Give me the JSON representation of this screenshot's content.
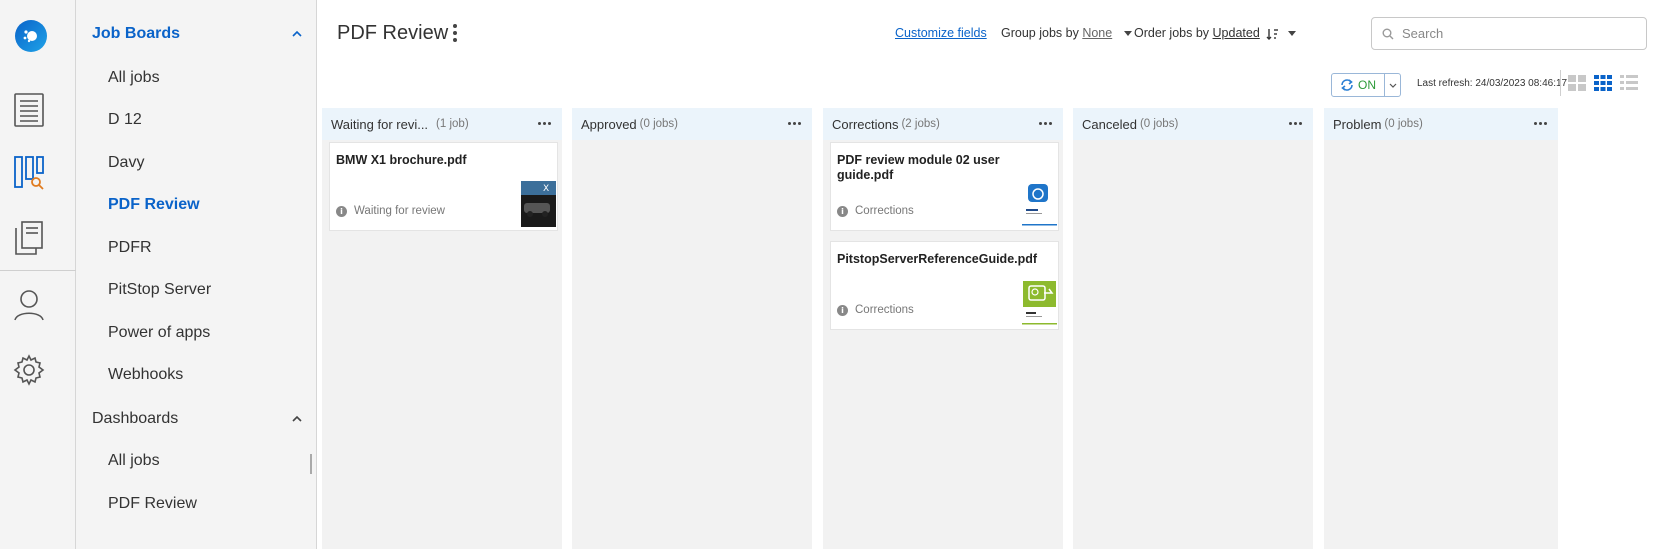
{
  "sidebar": {
    "sections": [
      {
        "label": "Job Boards",
        "items": [
          "All jobs",
          "D 12",
          "Davy",
          "PDF Review",
          "PDFR",
          "PitStop Server",
          "Power of apps",
          "Webhooks"
        ]
      },
      {
        "label": "Dashboards",
        "items": [
          "All jobs",
          "PDF Review"
        ]
      }
    ],
    "active_item": "PDF Review"
  },
  "header": {
    "title": "PDF Review",
    "customize_fields": "Customize fields",
    "group_label": "Group jobs by",
    "group_value": "None",
    "order_label": "Order jobs by",
    "order_value": "Updated",
    "search_placeholder": "Search"
  },
  "refresh": {
    "toggle_label": "ON",
    "last_refresh": "Last refresh: 24/03/2023 08:46:17"
  },
  "columns": [
    {
      "title": "Waiting for revi...",
      "count": "(1 job)",
      "cards": [
        {
          "name": "BMW X1 brochure.pdf",
          "status": "Waiting for review",
          "thumb": "bmw-thumbnail"
        }
      ]
    },
    {
      "title": "Approved",
      "count": "(0 jobs)",
      "cards": []
    },
    {
      "title": "Corrections",
      "count": "(2 jobs)",
      "cards": [
        {
          "name": "PDF review module 02 user guide.pdf",
          "status": "Corrections",
          "thumb": "guide-thumbnail"
        },
        {
          "name": "PitstopServerReferenceGuide.pdf",
          "status": "Corrections",
          "thumb": "pitstop-thumbnail"
        }
      ]
    },
    {
      "title": "Canceled",
      "count": "(0 jobs)",
      "cards": []
    },
    {
      "title": "Problem",
      "count": "(0 jobs)",
      "cards": []
    }
  ],
  "colors": {
    "accent": "#0a63c9",
    "on_green": "#2e9b3a",
    "column_header_bg": "#ebf4fb",
    "column_bg": "#f2f2f2"
  }
}
